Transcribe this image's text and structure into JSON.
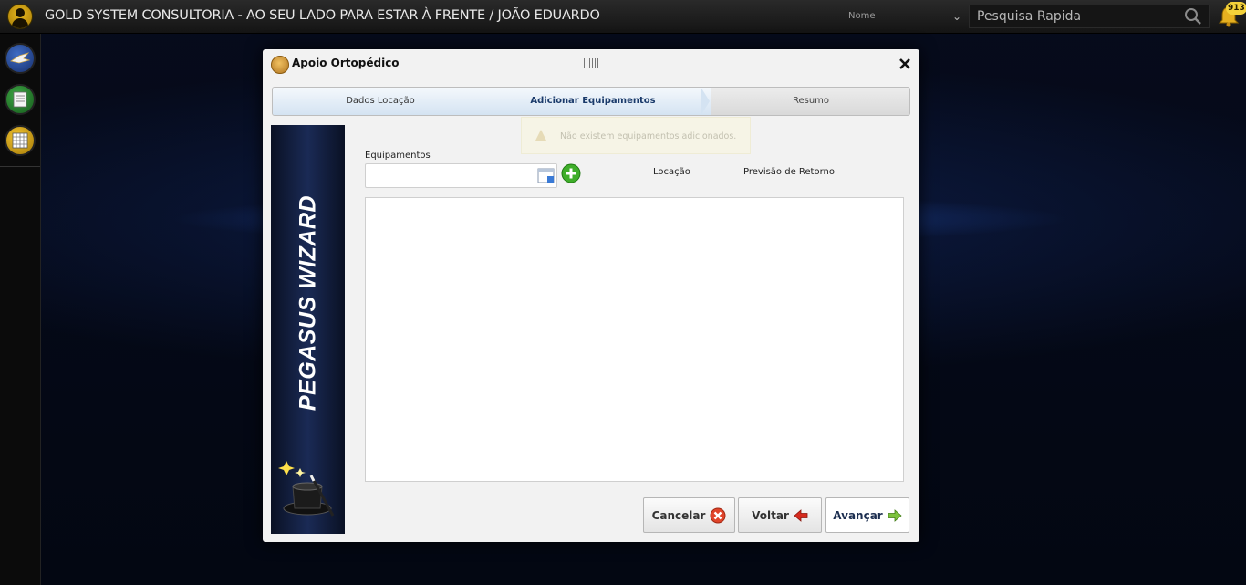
{
  "header": {
    "title": "GOLD SYSTEM CONSULTORIA - AO SEU LADO PARA ESTAR À FRENTE / JOÃO EDUARDO",
    "search_field_select": "Nome",
    "search_placeholder": "Pesquisa Rapida",
    "notification_count": "913"
  },
  "sidebar": {
    "items": [
      {
        "icon": "pegasus-icon"
      },
      {
        "icon": "list-icon"
      },
      {
        "icon": "grid-icon"
      }
    ]
  },
  "modal": {
    "title": "Apoio Ortopédico",
    "steps": [
      {
        "label": "Dados Locação",
        "state": "done"
      },
      {
        "label": "Adicionar Equipamentos",
        "state": "active"
      },
      {
        "label": "Resumo",
        "state": "pending"
      }
    ],
    "notice": "Não existem equipamentos adicionados.",
    "wizard_banner": "PEGASUS WIZARD",
    "form": {
      "equipamentos_label": "Equipamentos",
      "equipamentos_value": "",
      "columns": [
        "Locação",
        "Previsão de Retorno"
      ]
    },
    "buttons": {
      "cancel": "Cancelar",
      "back": "Voltar",
      "next": "Avançar"
    }
  },
  "colors": {
    "accent_blue": "#d4e3f2",
    "add_green": "#3fae2a",
    "cancel_red": "#e0442a",
    "back_red": "#d52b1e",
    "next_green": "#7cc23b"
  }
}
